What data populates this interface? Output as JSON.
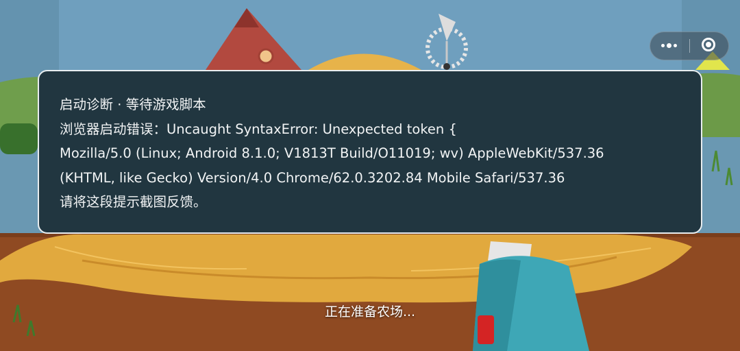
{
  "overlay": {
    "title": "启动诊断 · 等待游戏脚本",
    "error_line": "浏览器启动错误：Uncaught SyntaxError: Unexpected token {",
    "ua_line_1": "Mozilla/5.0 (Linux; Android 8.1.0; V1813T Build/O11019; wv) AppleWebKit/537.36",
    "ua_line_2": "(KHTML, like Gecko) Version/4.0 Chrome/62.0.3202.84 Mobile Safari/537.36",
    "feedback_line": "请将这段提示截图反馈。"
  },
  "loading": {
    "status_text": "正在准备农场..."
  },
  "capsule": {
    "more_icon": "more-dots-icon",
    "close_icon": "target-circle-icon"
  },
  "colors": {
    "panel_bg": "#213640",
    "panel_border": "#e9eef0",
    "text": "#f2f4f5",
    "sky": "#79a6c2",
    "dirt": "#8f4a22",
    "hay": "#e1a93e",
    "tool": "#3ea7b6"
  }
}
